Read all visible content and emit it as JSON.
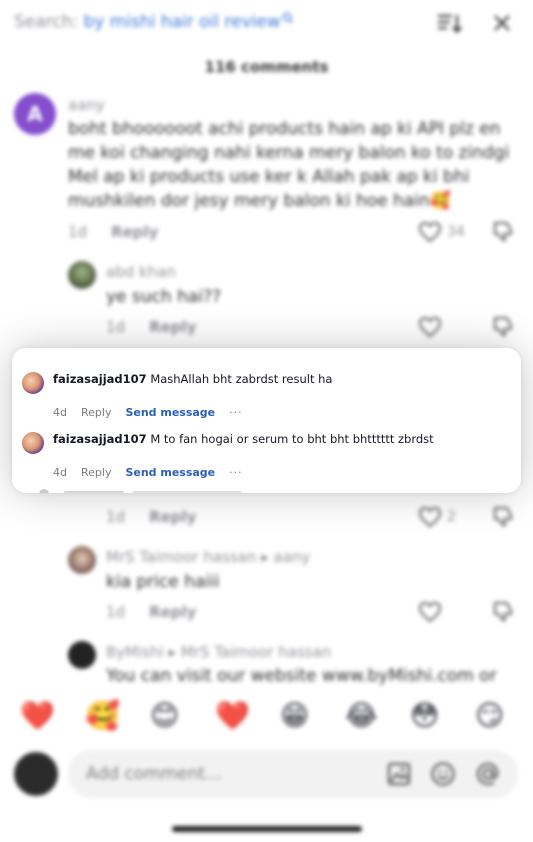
{
  "header": {
    "search_prefix": "Search: ",
    "search_query": "by mishi hair oil review",
    "comment_count": "116 comments"
  },
  "comments": [
    {
      "avatar_letter": "A",
      "avatar_color": "#7a3fc9",
      "author": "aany",
      "text_lines": [
        "boht bhoooooot achi products hain ap ki API plz en",
        "me koi changing nahi kerna mery balon ko to zindgi",
        "Mel ap ki products use ker k Allah pak ap ki bhi",
        "mushkilen dor jesy mery balon ki hoe hain🥰"
      ],
      "time": "1d",
      "reply_label": "Reply",
      "likes": "34"
    },
    {
      "author": "abd khan",
      "text": "ye such hai??",
      "time": "1d",
      "reply_label": "Reply"
    },
    {
      "time": "1d",
      "reply_label": "Reply",
      "likes": "2"
    },
    {
      "author": "MrS Taimoor hassan ▸ aany",
      "text": "kia price haiii",
      "time": "1d",
      "reply_label": "Reply"
    },
    {
      "author": "ByMishi ▸ MrS Taimoor hassan",
      "text": "You can visit our website www.byMishi.com or"
    }
  ],
  "popup": {
    "rows": [
      {
        "username": "faizasajjad107",
        "text": "MashAllah bht zabrdst result ha",
        "time": "4d",
        "reply_label": "Reply",
        "send_label": "Send message",
        "more_label": "···"
      },
      {
        "username": "faizasajjad107",
        "text": "M to fan hogai or serum to bht bht bhtttttt zbrdst",
        "time": "4d",
        "reply_label": "Reply",
        "send_label": "Send message",
        "more_label": "···"
      }
    ]
  },
  "emoji_bar": [
    "❤️",
    "🥰",
    "😊",
    "❤️",
    "😁",
    "😂",
    "😳",
    "😏"
  ],
  "input": {
    "placeholder": "Add comment..."
  },
  "colors": {
    "accent_link": "#2b5fb3",
    "search_query": "#2f6fd6",
    "muted_text": "#8a8b91"
  }
}
